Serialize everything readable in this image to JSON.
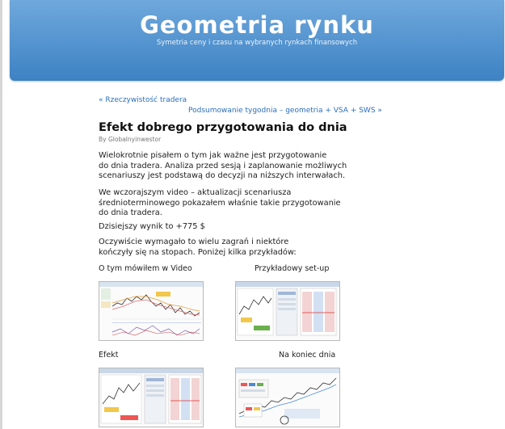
{
  "site": {
    "title": "Geometria rynku",
    "tagline": "Symetria ceny i czasu na wybranych rynkach finansowych"
  },
  "nav": {
    "prev": "« Rzeczywistość tradera",
    "next": "Podsumowanie tygodnia – geometria + VSA + SWS »"
  },
  "post": {
    "title": "Efekt dobrego przygotowania do dnia",
    "byline": "By Globalnyinwestor",
    "paragraphs": [
      "Wielokrotnie pisałem o tym jak ważne jest przygotowanie\ndo dnia tradera. Analiza przed sesją i zaplanowanie możliwych\nscenariuszy jest podstawą do decyzji na niższych interwałach.",
      "We wczorajszym video – aktualizacji scenariusza\nśrednioterminowego pokazałem właśnie takie przygotowanie\ndo dnia tradera.",
      "Dzisiejszy wynik to +775 $",
      "Oczywiście wymagało to wielu zagrań i niektóre\nkończyły się na stopach. Poniżej kilka przykładów:"
    ],
    "captions": [
      "O tym mówiłem w Video",
      "Przykładowy set-up",
      "Efekt",
      "Na koniec dnia"
    ]
  }
}
